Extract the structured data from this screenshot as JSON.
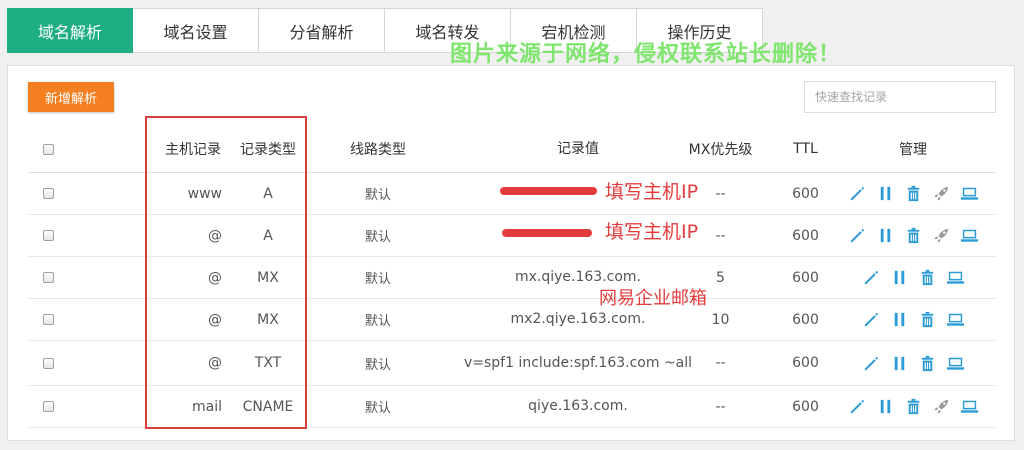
{
  "tabs": [
    {
      "label": "域名解析",
      "active": true
    },
    {
      "label": "域名设置",
      "active": false
    },
    {
      "label": "分省解析",
      "active": false
    },
    {
      "label": "域名转发",
      "active": false
    },
    {
      "label": "宕机检测",
      "active": false
    },
    {
      "label": "操作历史",
      "active": false
    }
  ],
  "toolbar": {
    "add_label": "新增解析",
    "search_placeholder": "快速查找记录"
  },
  "watermark": "图片来源于网络，侵权联系站长删除！",
  "table": {
    "headers": {
      "host": "主机记录",
      "type": "记录类型",
      "line": "线路类型",
      "value": "记录值",
      "mx": "MX优先级",
      "ttl": "TTL",
      "manage": "管理"
    },
    "rows": [
      {
        "host": "www",
        "type": "A",
        "line": "默认",
        "value": "",
        "mx": "--",
        "ttl": "600",
        "icons": [
          "edit-icon",
          "pause-icon",
          "delete-icon",
          "rocket-icon",
          "monitor-icon"
        ]
      },
      {
        "host": "@",
        "type": "A",
        "line": "默认",
        "value": "",
        "mx": "--",
        "ttl": "600",
        "icons": [
          "edit-icon",
          "pause-icon",
          "delete-icon",
          "rocket-icon",
          "monitor-icon"
        ]
      },
      {
        "host": "@",
        "type": "MX",
        "line": "默认",
        "value": "mx.qiye.163.com.",
        "mx": "5",
        "ttl": "600",
        "icons": [
          "edit-icon",
          "pause-icon",
          "delete-icon",
          "monitor-icon"
        ]
      },
      {
        "host": "@",
        "type": "MX",
        "line": "默认",
        "value": "mx2.qiye.163.com.",
        "mx": "10",
        "ttl": "600",
        "icons": [
          "edit-icon",
          "pause-icon",
          "delete-icon",
          "monitor-icon"
        ]
      },
      {
        "host": "@",
        "type": "TXT",
        "line": "默认",
        "value": "v=spf1 include:spf.163.com ~all",
        "mx": "--",
        "ttl": "600",
        "icons": [
          "edit-icon",
          "pause-icon",
          "delete-icon",
          "monitor-icon"
        ]
      },
      {
        "host": "mail",
        "type": "CNAME",
        "line": "默认",
        "value": "qiye.163.com.",
        "mx": "--",
        "ttl": "600",
        "icons": [
          "edit-icon",
          "pause-icon",
          "delete-icon",
          "rocket-icon",
          "monitor-icon"
        ]
      }
    ]
  },
  "annotations": {
    "host_ip_note_1": "填写主机IP",
    "host_ip_note_2": "填写主机IP",
    "netease_note": "网易企业邮箱"
  },
  "colors": {
    "tab_active": "#1fae84",
    "add_button": "#f47f20",
    "action_icon": "#2a9bd5",
    "rocket_icon": "#999999",
    "annotation_red": "#e43c3c",
    "watermark": "#7fe56e"
  }
}
